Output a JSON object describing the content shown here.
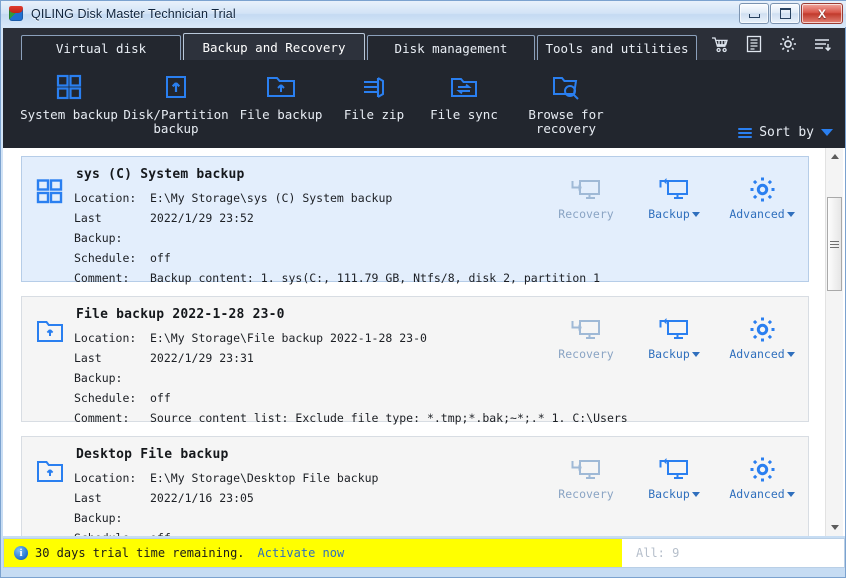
{
  "window": {
    "title": "QILING Disk Master Technician Trial",
    "logo_icon": "qiling-cube-logo",
    "controls": {
      "minimize_icon": "minimize-icon",
      "maximize_icon": "maximize-icon",
      "close_label": "X"
    }
  },
  "tabs": [
    {
      "label": "Virtual disk",
      "active": false
    },
    {
      "label": "Backup and Recovery",
      "active": true
    },
    {
      "label": "Disk management",
      "active": false
    },
    {
      "label": "Tools and utilities",
      "active": false
    }
  ],
  "tab_icons": [
    {
      "name": "shopping-cart-icon"
    },
    {
      "name": "list-document-icon"
    },
    {
      "name": "gear-icon"
    },
    {
      "name": "menu-sort-icon"
    }
  ],
  "toolbar": {
    "items": [
      {
        "label": "System backup",
        "icon": "grid-squares-icon"
      },
      {
        "label": "Disk/Partition\nbackup",
        "icon": "disk-partition-icon"
      },
      {
        "label": "File backup",
        "icon": "folder-backup-icon"
      },
      {
        "label": "File zip",
        "icon": "file-zip-icon"
      },
      {
        "label": "File sync",
        "icon": "folder-sync-icon"
      },
      {
        "label": "Browse for\nrecovery",
        "icon": "folder-search-icon"
      }
    ],
    "sort_by_label": "Sort by",
    "sort_icon": "sort-lines-icon",
    "sort_caret_icon": "chevron-down-icon"
  },
  "labels": {
    "location": "Location:",
    "last_backup": "Last Backup:",
    "schedule": "Schedule:",
    "comment": "Comment:"
  },
  "actions": {
    "recovery": "Recovery",
    "backup": "Backup",
    "advanced": "Advanced"
  },
  "cards": [
    {
      "title": "sys (C) System backup",
      "icon": "system-backup-icon",
      "selected": true,
      "location": "E:\\My Storage\\sys (C) System backup",
      "last_backup": "2022/1/29 23:52",
      "schedule": "off",
      "comment": "Backup content:  1. sys(C:,  111.79 GB,  Ntfs/8,  disk 2,  partition 1"
    },
    {
      "title": "File backup 2022-1-28 23-0",
      "icon": "file-backup-icon",
      "selected": false,
      "location": "E:\\My Storage\\File backup 2022-1-28 23-0",
      "last_backup": "2022/1/29 23:31",
      "schedule": "off",
      "comment": "Source content list:  Exclude file type: *.tmp;*.bak;~*;.*      1. C:\\Users"
    },
    {
      "title": "Desktop File backup",
      "icon": "file-backup-icon",
      "selected": false,
      "location": "E:\\My Storage\\Desktop File backup",
      "last_backup": "2022/1/16 23:05",
      "schedule": "off",
      "comment": ""
    }
  ],
  "scrollbar": {
    "up_icon": "scroll-up-arrow-icon",
    "down_icon": "scroll-down-arrow-icon",
    "thumb_icon": "scroll-thumb-grip"
  },
  "statusbar": {
    "info_icon": "info-icon",
    "info_glyph": "i",
    "trial_text": "30 days trial time remaining.",
    "activate_label": "Activate now",
    "count_text": "All: 9"
  },
  "colors": {
    "accent_blue": "#2a7ff0",
    "link_blue": "#2f6fbd",
    "toolbar_dark": "#22262e",
    "tabbar_dark": "#2b2f38",
    "selected_card": "#e3eefc",
    "trial_yellow": "#ffff00"
  }
}
